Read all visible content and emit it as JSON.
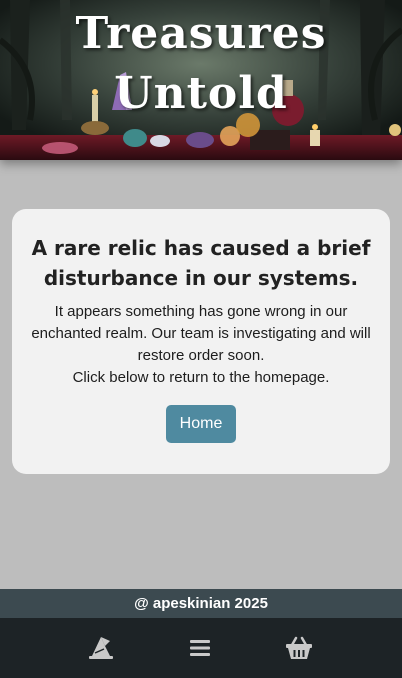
{
  "hero": {
    "title_line1": "Treasures",
    "title_line2": "Untold",
    "image": "witchy-altar-with-crystals-potions-candles"
  },
  "error_card": {
    "title": "A rare relic has caused a brief disturbance in our systems.",
    "message_line1": "It appears something has gone wrong in our enchanted realm. Our team is investigating and will restore order soon.",
    "message_line2": "Click below to return to the homepage.",
    "home_button_label": "Home"
  },
  "footer": {
    "credit": "@ apeskinian 2025"
  },
  "bottom_nav": {
    "items": [
      {
        "icon": "wizard-hat-icon"
      },
      {
        "icon": "menu-icon"
      },
      {
        "icon": "basket-icon"
      }
    ]
  },
  "colors": {
    "page_background": "#bdbdbd",
    "card_background": "#f2f2f2",
    "button_accent": "#4f8aa0",
    "footer_credit_bar": "#3c4a50",
    "bottom_nav": "#1d2326",
    "nav_icon": "#c9c9c9"
  }
}
